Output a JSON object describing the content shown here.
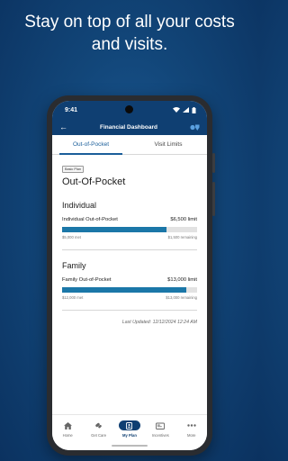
{
  "headline": "Stay on top of all your costs and visits.",
  "status_bar": {
    "time": "9:41"
  },
  "header": {
    "title": "Financial Dashboard",
    "back_icon": "arrow-left-icon",
    "right_icon": "shield-icon"
  },
  "tabs": [
    {
      "label": "Out-of-Pocket",
      "active": true
    },
    {
      "label": "Visit Limits",
      "active": false
    }
  ],
  "plan_badge": "Basic Plan",
  "page_title": "Out-Of-Pocket",
  "sections": [
    {
      "title": "Individual",
      "item_label": "Individual Out-of-Pocket",
      "limit": "$6,500 limit",
      "met": "$5,000 met",
      "remaining": "$1,500 remaining",
      "progress": 0.77
    },
    {
      "title": "Family",
      "item_label": "Family Out-of-Pocket",
      "limit": "$13,000 limit",
      "met": "$12,000 met",
      "remaining": "$13,000 remaining",
      "progress": 0.92
    }
  ],
  "last_updated": "Last Updated: 12/12/2024 12:24 AM",
  "nav": [
    {
      "label": "Home",
      "icon": "home-icon",
      "active": false
    },
    {
      "label": "Get Care",
      "icon": "stethoscope-icon",
      "active": false
    },
    {
      "label": "My Plan",
      "icon": "id-card-icon",
      "active": true
    },
    {
      "label": "Incentives",
      "icon": "wallet-icon",
      "active": false
    },
    {
      "label": "More",
      "icon": "more-dots-icon",
      "active": false
    }
  ],
  "colors": {
    "brand": "#0f3f72",
    "accent": "#1a5e9a",
    "bar": "#1b77a8"
  }
}
